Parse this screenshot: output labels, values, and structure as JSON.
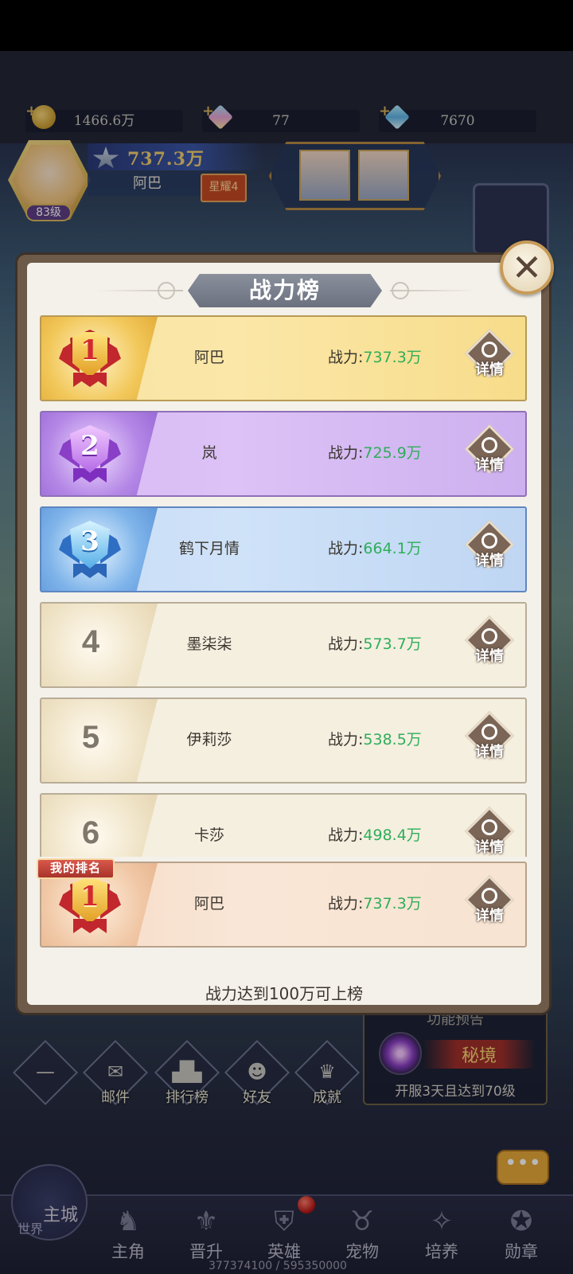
{
  "currencies": [
    {
      "icon": "gold-coin-icon",
      "value": "1466.6万"
    },
    {
      "icon": "rainbow-gem-icon",
      "value": "77"
    },
    {
      "icon": "diamond-icon",
      "value": "7670"
    }
  ],
  "player": {
    "level": "83级",
    "power": "737.3万",
    "name": "阿巴",
    "rank_tag": "星耀4"
  },
  "menu": {
    "items": [
      {
        "label": "",
        "icon": "collapse-icon"
      },
      {
        "label": "邮件",
        "icon": "mail-icon"
      },
      {
        "label": "排行榜",
        "icon": "podium-icon"
      },
      {
        "label": "好友",
        "icon": "friends-icon"
      },
      {
        "label": "成就",
        "icon": "trophy-icon"
      }
    ]
  },
  "preview": {
    "title": "功能预告",
    "name": "秘境",
    "desc": "开服3天且达到70级"
  },
  "nav": {
    "home_label": "主城",
    "world_label": "世界",
    "items": [
      {
        "label": "主角",
        "icon": "hero-helmet-icon"
      },
      {
        "label": "晋升",
        "icon": "promotion-icon"
      },
      {
        "label": "英雄",
        "icon": "knight-icon"
      },
      {
        "label": "宠物",
        "icon": "pet-icon"
      },
      {
        "label": "培养",
        "icon": "training-icon"
      },
      {
        "label": "勋章",
        "icon": "medal-icon"
      }
    ],
    "exp_text": "377374100 / 595350000"
  },
  "modal": {
    "title": "战力榜",
    "power_prefix": "战力:",
    "detail_label": "详情",
    "rows": [
      {
        "rank": "1",
        "name": "阿巴",
        "power": "737.3万"
      },
      {
        "rank": "2",
        "name": "岚",
        "power": "725.9万"
      },
      {
        "rank": "3",
        "name": "鹤下月情",
        "power": "664.1万"
      },
      {
        "rank": "4",
        "name": "墨柒柒",
        "power": "573.7万"
      },
      {
        "rank": "5",
        "name": "伊莉莎",
        "power": "538.5万"
      },
      {
        "rank": "6",
        "name": "卡莎",
        "power": "498.4万"
      }
    ],
    "mine": {
      "badge": "我的排名",
      "rank": "1",
      "name": "阿巴",
      "power": "737.3万"
    },
    "footer": "战力达到100万可上榜"
  },
  "colors": {
    "power_value": "#2fae5a",
    "gold_rank": "#f2c85b",
    "silver_rank": "#b487e6",
    "bronze_rank": "#7fb4ea"
  }
}
